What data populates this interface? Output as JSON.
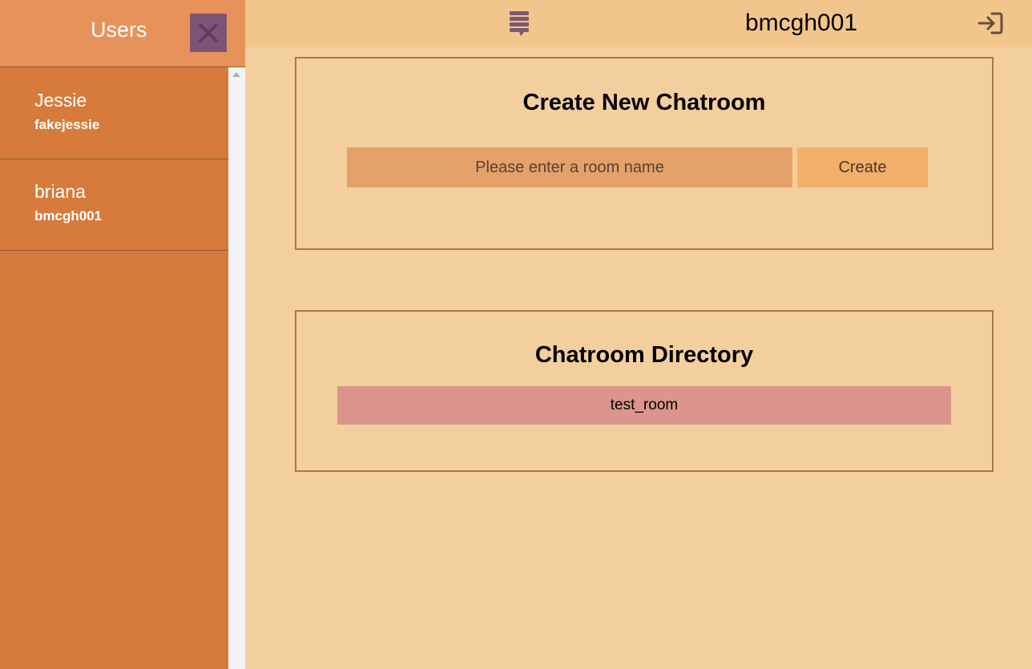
{
  "sidebar": {
    "title": "Users",
    "users": [
      {
        "name": "Jessie",
        "handle": "fakejessie"
      },
      {
        "name": "briana",
        "handle": "bmcgh001"
      }
    ]
  },
  "topbar": {
    "username": "bmcgh001"
  },
  "create_panel": {
    "title": "Create New Chatroom",
    "input_placeholder": "Please enter a room name",
    "create_label": "Create"
  },
  "directory_panel": {
    "title": "Chatroom Directory",
    "rooms": [
      "test_room"
    ]
  },
  "colors": {
    "sidebar": "#d67b3c",
    "sidebar_header": "#e6925a",
    "close_button": "#7e5476",
    "topbar": "#f2c58c",
    "background": "#f4cf9e",
    "room_item": "#dc958c"
  }
}
